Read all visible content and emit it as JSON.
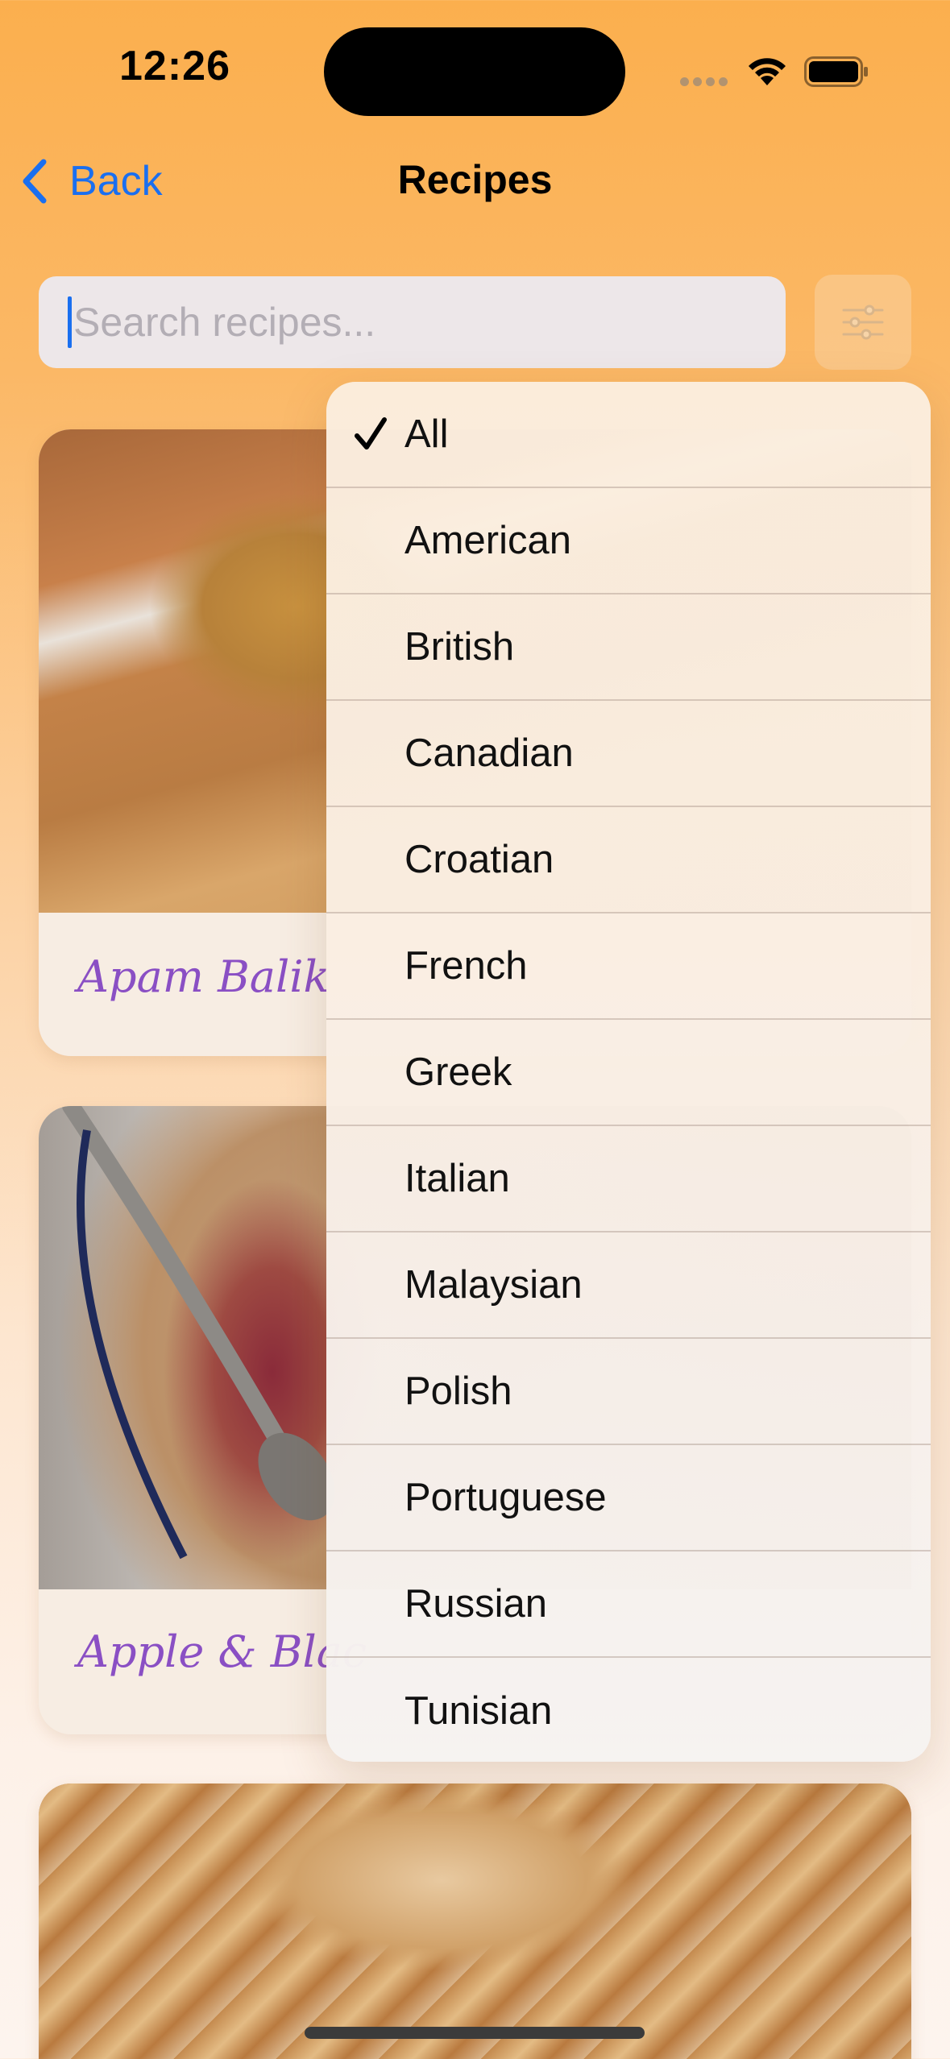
{
  "status_bar": {
    "time": "12:26",
    "icons": [
      "cellular-dots-icon",
      "wifi-icon",
      "battery-icon"
    ]
  },
  "nav": {
    "back_label": "Back",
    "title": "Recipes"
  },
  "search": {
    "placeholder": "Search recipes...",
    "value": ""
  },
  "filter_button": {
    "icon": "filter-sliders-icon"
  },
  "recipes": [
    {
      "title": "Apam Balik"
    },
    {
      "title": "Apple & Blac"
    },
    {
      "title": ""
    }
  ],
  "filter_menu": {
    "selected": "All",
    "options": [
      "All",
      "American",
      "British",
      "Canadian",
      "Croatian",
      "French",
      "Greek",
      "Italian",
      "Malaysian",
      "Polish",
      "Portuguese",
      "Russian",
      "Tunisian"
    ]
  },
  "colors": {
    "accent": "#1a6ff0",
    "recipe_title": "#8a4fc4",
    "background_top": "#fbaf4e",
    "background_bottom": "#fdf4ee"
  }
}
